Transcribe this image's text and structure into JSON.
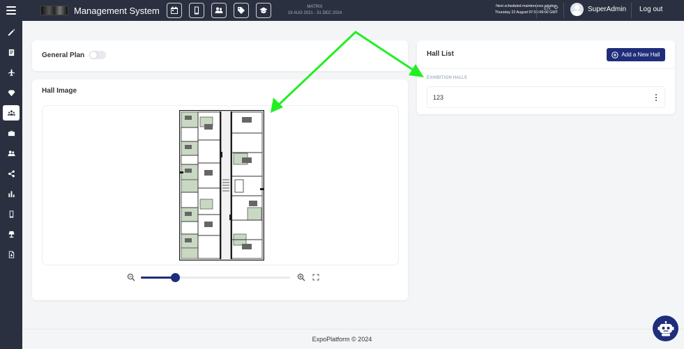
{
  "header": {
    "app_title": "Management System",
    "event_name": "MATRIX",
    "event_dates": "19 AUG 2021 - 31 DEC 2024",
    "maintenance_line1": "Next scheduled maintenance window:",
    "maintenance_line2": "Thursday 22 August 07:00-09:00 GMT",
    "language": "EN",
    "username": "SuperAdmin",
    "logout_label": "Log out",
    "toolbar_icons": [
      "calendar-icon",
      "mobile-icon",
      "people-icon",
      "tag-icon",
      "graduation-cap-icon"
    ]
  },
  "sidebar": {
    "items": [
      {
        "icon": "pencil-icon"
      },
      {
        "icon": "document-icon"
      },
      {
        "icon": "airplane-icon"
      },
      {
        "icon": "diamond-icon"
      },
      {
        "icon": "meeting-icon",
        "active": true
      },
      {
        "icon": "briefcase-icon"
      },
      {
        "icon": "users-icon"
      },
      {
        "icon": "share-icon"
      },
      {
        "icon": "bar-chart-icon"
      },
      {
        "icon": "mobile-icon"
      },
      {
        "icon": "lamp-icon"
      },
      {
        "icon": "file-export-icon"
      }
    ]
  },
  "general_plan": {
    "label": "General Plan",
    "enabled": false
  },
  "hall_image": {
    "title": "Hall Image",
    "zoom_level": 0.23
  },
  "hall_list": {
    "title": "Hall List",
    "add_button_label": "Add a New Hall",
    "section_label": "EXHIBITION HALLS",
    "halls": [
      {
        "name": "123"
      }
    ]
  },
  "footer": {
    "text": "ExpoPlatform © 2024"
  },
  "colors": {
    "nav_bg": "#2b3040",
    "primary": "#1f2d7b",
    "page_bg": "#f4f5f7",
    "annotation_arrow": "#22ee22"
  }
}
